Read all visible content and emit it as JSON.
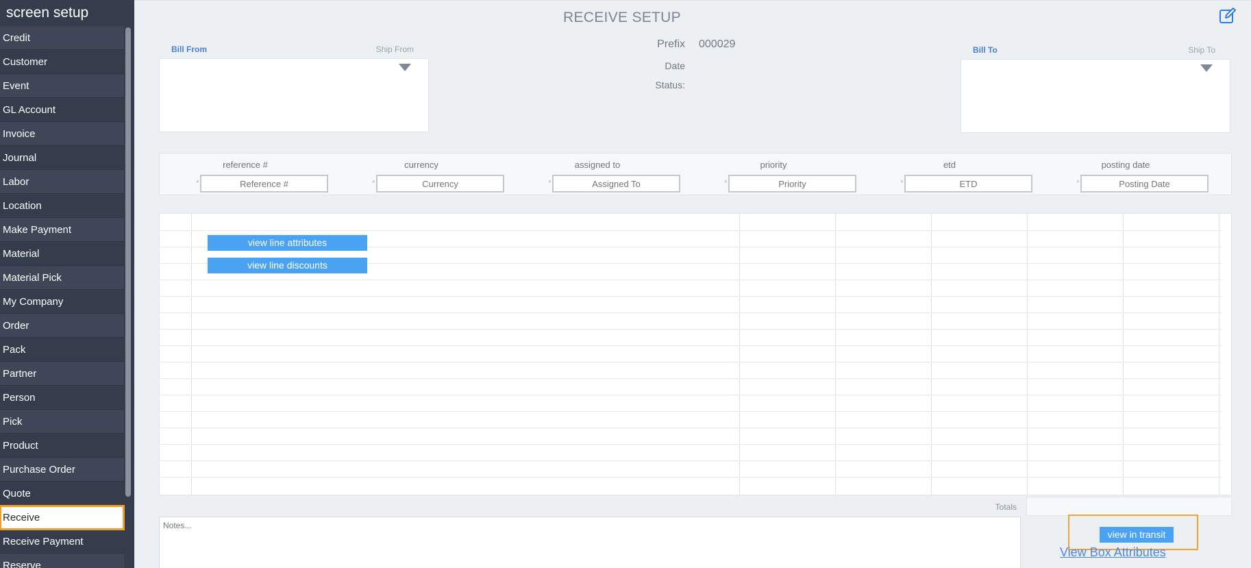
{
  "sidebar": {
    "title": "screen setup",
    "items": [
      {
        "label": "Credit"
      },
      {
        "label": "Customer"
      },
      {
        "label": "Event"
      },
      {
        "label": "GL Account"
      },
      {
        "label": "Invoice"
      },
      {
        "label": "Journal"
      },
      {
        "label": "Labor"
      },
      {
        "label": "Location"
      },
      {
        "label": "Make Payment"
      },
      {
        "label": "Material"
      },
      {
        "label": "Material Pick"
      },
      {
        "label": "My Company"
      },
      {
        "label": "Order"
      },
      {
        "label": "Pack"
      },
      {
        "label": "Partner"
      },
      {
        "label": "Person"
      },
      {
        "label": "Pick"
      },
      {
        "label": "Product"
      },
      {
        "label": "Purchase Order"
      },
      {
        "label": "Quote"
      },
      {
        "label": "Receive"
      },
      {
        "label": "Receive Payment"
      },
      {
        "label": "Reserve"
      }
    ],
    "active_item": "Receive"
  },
  "header": {
    "title": "RECEIVE SETUP",
    "edit_icon": "pencil-square-icon"
  },
  "bill_from": {
    "primary_label": "Bill From",
    "secondary_label": "Ship From"
  },
  "bill_to": {
    "primary_label": "Bill To",
    "secondary_label": "Ship To"
  },
  "meta": {
    "prefix_label": "Prefix",
    "prefix_value": "000029",
    "date_label": "Date",
    "status_label": "Status:"
  },
  "fields": [
    {
      "label": "reference #",
      "placeholder": "Reference #"
    },
    {
      "label": "currency",
      "placeholder": "Currency"
    },
    {
      "label": "assigned to",
      "placeholder": "Assigned To"
    },
    {
      "label": "priority",
      "placeholder": "Priority"
    },
    {
      "label": "etd",
      "placeholder": "ETD"
    },
    {
      "label": "posting date",
      "placeholder": "Posting Date"
    }
  ],
  "grid": {
    "view_line_attributes": "view line attributes",
    "view_line_discounts": "view line discounts"
  },
  "totals": {
    "label": "Totals"
  },
  "notes": {
    "placeholder": "Notes..."
  },
  "actions": {
    "view_in_transit": "view in transit",
    "view_box_attributes": "View Box Attributes"
  },
  "colors": {
    "sidebar_bg": "#353d4d",
    "accent_blue": "#4aa3f2",
    "highlight_orange": "#f39c2b",
    "link_blue": "#4a86e8"
  }
}
